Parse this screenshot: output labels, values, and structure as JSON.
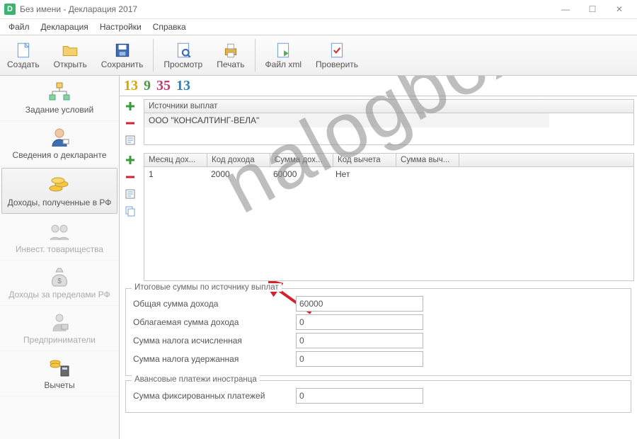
{
  "window": {
    "title": "Без имени - Декларация 2017"
  },
  "menu": {
    "file": "Файл",
    "decl": "Декларация",
    "settings": "Настройки",
    "help": "Справка"
  },
  "toolbar": {
    "create": "Создать",
    "open": "Открыть",
    "save": "Сохранить",
    "preview": "Просмотр",
    "print": "Печать",
    "xml": "Файл xml",
    "check": "Проверить"
  },
  "sidebar": {
    "items": [
      {
        "label": "Задание условий"
      },
      {
        "label": "Сведения о декларанте"
      },
      {
        "label": "Доходы, полученные в РФ"
      },
      {
        "label": "Инвест. товарищества"
      },
      {
        "label": "Доходы за пределами РФ"
      },
      {
        "label": "Предприниматели"
      },
      {
        "label": "Вычеты"
      }
    ]
  },
  "rates": {
    "a": "13",
    "b": "9",
    "c": "35",
    "d": "13"
  },
  "sources": {
    "header": "Источники выплат",
    "row": "ООО \"КОНСАЛТИНГ-ВЕЛА\""
  },
  "income_table": {
    "headers": {
      "month": "Месяц дох...",
      "code": "Код дохода",
      "sum": "Сумма дох...",
      "dcode": "Код вычета",
      "dsum": "Сумма выч..."
    },
    "row": {
      "month": "1",
      "code": "2000",
      "sum": "60000",
      "dcode": "Нет",
      "dsum": ""
    }
  },
  "totals": {
    "legend": "Итоговые суммы по источнику выплат",
    "total_income_label": "Общая сумма дохода",
    "total_income": "60000",
    "taxable_label": "Облагаемая сумма дохода",
    "taxable": "0",
    "calc_label": "Сумма налога исчисленная",
    "calc": "0",
    "withheld_label": "Сумма налога удержанная",
    "withheld": "0"
  },
  "advance": {
    "legend": "Авансовые платежи иностранца",
    "fixed_label": "Сумма фиксированных платежей",
    "fixed": "0"
  },
  "watermark": "nalogbox.ru"
}
